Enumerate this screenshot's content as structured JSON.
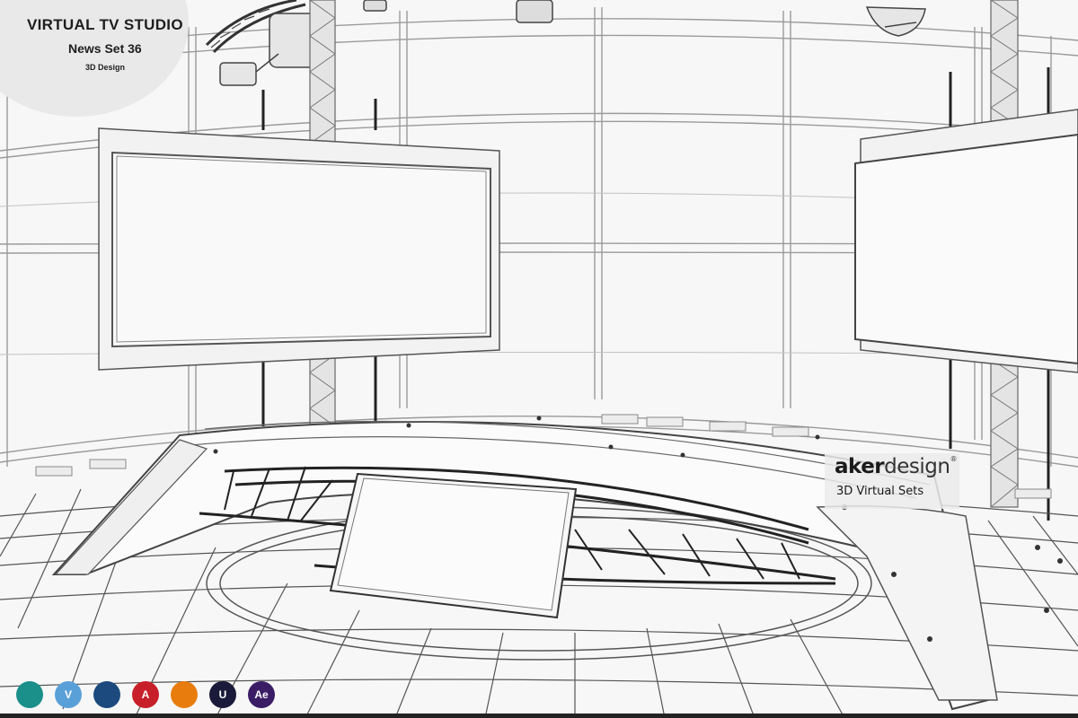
{
  "title_block": {
    "title": "VIRTUAL TV STUDIO",
    "subtitle": "News Set 36",
    "caption": "3D Design"
  },
  "brand": {
    "name_bold": "aker",
    "name_light": "design",
    "registered": "®",
    "tagline": "3D Virtual Sets"
  },
  "software_icons": [
    {
      "name": "3ds-max-icon",
      "glyph": "",
      "color": "#1b8f8a"
    },
    {
      "name": "vray-icon",
      "glyph": "V",
      "color": "#5aa0d8"
    },
    {
      "name": "cinema4d-icon",
      "glyph": "",
      "color": "#1c4a7e"
    },
    {
      "name": "autocad-icon",
      "glyph": "A",
      "color": "#c8202a"
    },
    {
      "name": "blender-icon",
      "glyph": "",
      "color": "#e87d0d"
    },
    {
      "name": "unreal-icon",
      "glyph": "U",
      "color": "#1a1a3a"
    },
    {
      "name": "after-effects-icon",
      "glyph": "Ae",
      "color": "#3b1d66"
    }
  ]
}
